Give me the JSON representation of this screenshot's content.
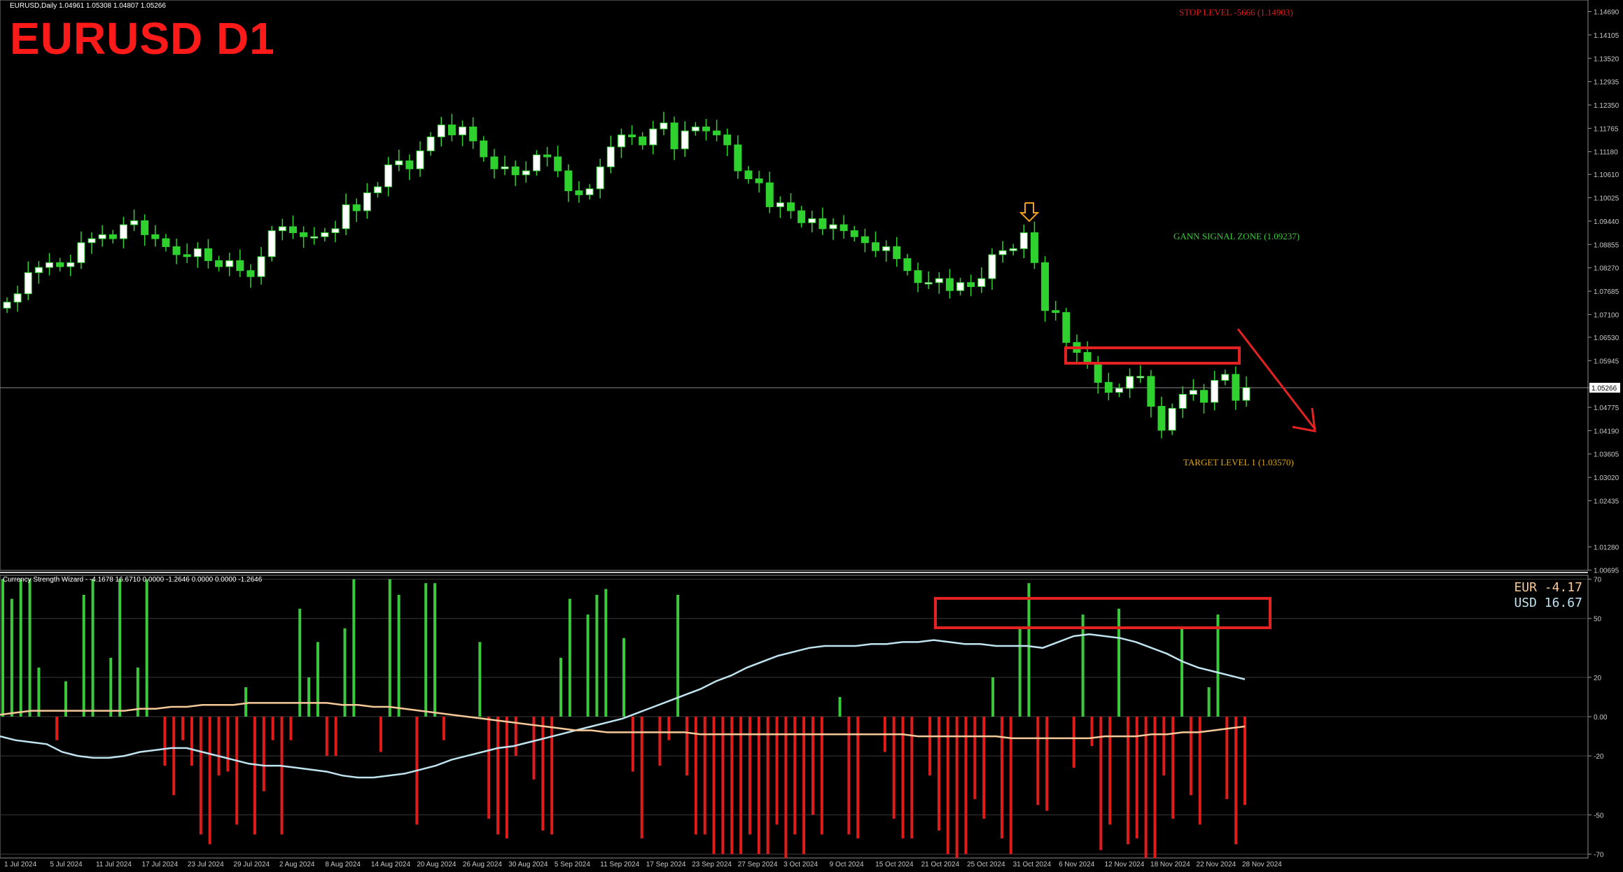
{
  "window": {
    "symbol_line": "EURUSD,Daily  1.04961 1.05308 1.04807 1.05266",
    "big_title": "EURUSD D1",
    "indicator_line": "Currency Strength Wizard - -4.1678 16.6710 0.0000 -1.2646 0.0000 0.0000 -1.2646"
  },
  "annotations": {
    "stop": "STOP LEVEL -5666 (1.14903)",
    "gann": "GANN SIGNAL ZONE (1.09237)",
    "target": "TARGET LEVEL 1 (1.03570)"
  },
  "legend": {
    "eur": "EUR -4.17",
    "usd": "USD 16.67"
  },
  "current_price_label": "1.05266",
  "colors": {
    "background": "#000000",
    "bull_candle": "#ffffff",
    "bear_candle": "#2fd12f",
    "wick": "#2fd12f",
    "annotation_stop": "#e11a1a",
    "annotation_gann": "#3cc83c",
    "annotation_target": "#d9a514",
    "highlight_box": "#e52222",
    "eur_line": "#f6c999",
    "usd_line": "#bfe3ef",
    "hist_positive": "#3cc83c",
    "hist_negative": "#e11a1a"
  },
  "chart_data": [
    {
      "type": "candlestick",
      "title": "EURUSD D1",
      "ylim": [
        1.0069,
        1.1498
      ],
      "y_ticks": [
        "1.14690",
        "1.14105",
        "1.13520",
        "1.12935",
        "1.12350",
        "1.11765",
        "1.11180",
        "1.10610",
        "1.10025",
        "1.09440",
        "1.08855",
        "1.08270",
        "1.07685",
        "1.07100",
        "1.06530",
        "1.05945",
        "1.05266",
        "1.04775",
        "1.04190",
        "1.03605",
        "1.03020",
        "1.02435",
        "1.01280",
        "1.00695"
      ],
      "x_labels": [
        "1 Jul 2024",
        "5 Jul 2024",
        "11 Jul 2024",
        "17 Jul 2024",
        "23 Jul 2024",
        "29 Jul 2024",
        "2 Aug 2024",
        "8 Aug 2024",
        "14 Aug 2024",
        "20 Aug 2024",
        "26 Aug 2024",
        "30 Aug 2024",
        "5 Sep 2024",
        "11 Sep 2024",
        "17 Sep 2024",
        "23 Sep 2024",
        "27 Sep 2024",
        "3 Oct 2024",
        "9 Oct 2024",
        "15 Oct 2024",
        "21 Oct 2024",
        "25 Oct 2024",
        "31 Oct 2024",
        "6 Nov 2024",
        "12 Nov 2024",
        "18 Nov 2024",
        "22 Nov 2024",
        "28 Nov 2024"
      ],
      "closes": [
        1.0741,
        1.0762,
        1.0815,
        1.0828,
        1.084,
        1.083,
        1.084,
        1.089,
        1.09,
        1.091,
        1.09,
        1.0935,
        1.0945,
        1.091,
        1.09,
        1.088,
        1.086,
        1.0855,
        1.0875,
        1.0845,
        1.083,
        1.0845,
        1.082,
        1.0805,
        1.0855,
        1.092,
        1.093,
        1.0915,
        1.0905,
        1.0905,
        1.0915,
        1.0925,
        1.0985,
        1.097,
        1.1015,
        1.103,
        1.1085,
        1.1095,
        1.1075,
        1.112,
        1.1155,
        1.1185,
        1.116,
        1.118,
        1.1145,
        1.1105,
        1.1075,
        1.108,
        1.106,
        1.107,
        1.111,
        1.1105,
        1.107,
        1.102,
        1.101,
        1.1025,
        1.108,
        1.113,
        1.116,
        1.1155,
        1.1135,
        1.1175,
        1.119,
        1.1125,
        1.117,
        1.118,
        1.117,
        1.116,
        1.1135,
        1.107,
        1.105,
        1.104,
        1.098,
        1.099,
        1.097,
        1.094,
        1.095,
        1.0925,
        1.0935,
        1.092,
        1.0905,
        1.089,
        1.087,
        1.088,
        1.085,
        1.082,
        1.079,
        1.079,
        1.08,
        1.077,
        1.079,
        1.078,
        1.08,
        1.086,
        1.087,
        1.0875,
        1.0915,
        1.084,
        1.072,
        1.0715,
        1.064,
        1.0615,
        1.059,
        1.054,
        1.0515,
        1.0525,
        1.0555,
        1.0555,
        1.048,
        1.042,
        1.0475,
        1.051,
        1.052,
        1.049,
        1.0545,
        1.056,
        1.0495,
        1.0527
      ],
      "notes": "white=bullish candle, green=bearish candle; red arrow points down from ~1.0700 toward ~1.0450"
    },
    {
      "type": "bar+line",
      "title": "Currency Strength Wizard",
      "ylim": [
        -72,
        72
      ],
      "y_ticks": [
        "70",
        "50",
        "20",
        "0.00",
        "-20",
        "-50",
        "-70"
      ],
      "series": [
        {
          "name": "EUR",
          "values": [
            -10,
            -12,
            -13,
            -14,
            -18,
            -20,
            -21,
            -21,
            -20,
            -18,
            -17,
            -16,
            -16,
            -18,
            -20,
            -22,
            -24,
            -25,
            -25,
            -26,
            -27,
            -28,
            -30,
            -31,
            -31,
            -30,
            -29,
            -27,
            -25,
            -22,
            -20,
            -18,
            -16,
            -15,
            -13,
            -11,
            -9,
            -7,
            -5,
            -3,
            -1,
            2,
            5,
            8,
            11,
            14,
            18,
            21,
            25,
            28,
            31,
            33,
            35,
            36,
            36,
            36,
            37,
            37,
            38,
            38,
            39,
            38,
            37,
            37,
            36,
            36,
            36,
            35,
            38,
            41,
            42,
            41,
            40,
            38,
            35,
            32,
            28,
            25,
            23,
            21,
            19
          ],
          "color": "#bfe3ef"
        },
        {
          "name": "USD",
          "values": [
            1,
            2,
            3,
            3,
            3,
            3,
            3,
            3,
            3,
            4,
            4,
            5,
            5,
            6,
            6,
            6,
            7,
            7,
            7,
            7,
            7,
            7,
            6,
            6,
            5,
            5,
            4,
            3,
            2,
            1,
            0,
            -1,
            -2,
            -3,
            -4,
            -5,
            -6,
            -7,
            -7,
            -8,
            -8,
            -8,
            -8,
            -8,
            -8,
            -9,
            -9,
            -9,
            -9,
            -9,
            -9,
            -9,
            -9,
            -9,
            -9,
            -9,
            -9,
            -9,
            -9,
            -10,
            -10,
            -10,
            -10,
            -10,
            -10,
            -11,
            -11,
            -11,
            -11,
            -11,
            -11,
            -10,
            -10,
            -10,
            -9,
            -9,
            -8,
            -8,
            -7,
            -6,
            -5
          ],
          "color": "#f6c999"
        }
      ],
      "histogram": [
        70,
        60,
        70,
        70,
        25,
        0,
        -12,
        18,
        0,
        62,
        70,
        0,
        30,
        70,
        0,
        25,
        70,
        0,
        -25,
        -40,
        -12,
        -25,
        -60,
        -65,
        -30,
        -28,
        -55,
        15,
        -60,
        -38,
        -12,
        -60,
        -12,
        55,
        20,
        38,
        -20,
        -20,
        45,
        70,
        0,
        0,
        -18,
        70,
        62,
        0,
        -55,
        68,
        68,
        -12,
        0,
        0,
        0,
        38,
        -52,
        -60,
        -62,
        -20,
        0,
        -32,
        -58,
        -60,
        30,
        60,
        0,
        52,
        62,
        65,
        0,
        40,
        -28,
        -62,
        0,
        -25,
        -12,
        62,
        -30,
        -60,
        -60,
        -70,
        -70,
        -70,
        -70,
        -60,
        -70,
        -70,
        -55,
        -72,
        -60,
        -70,
        -50,
        -60,
        0,
        10,
        -60,
        -62,
        0,
        0,
        -18,
        -52,
        -62,
        -62,
        0,
        -30,
        -58,
        -70,
        -72,
        -70,
        -42,
        -52,
        20,
        -62,
        -70,
        45,
        68,
        -45,
        -48,
        0,
        0,
        -26,
        52,
        -15,
        -68,
        -55,
        55,
        -65,
        -62,
        -72,
        -72,
        -30,
        -52,
        45,
        -40,
        -55,
        15,
        52,
        -42,
        -65,
        -45
      ],
      "highlight_box": "red box around upper bars near Oct 31 – Nov 28 2024"
    }
  ]
}
